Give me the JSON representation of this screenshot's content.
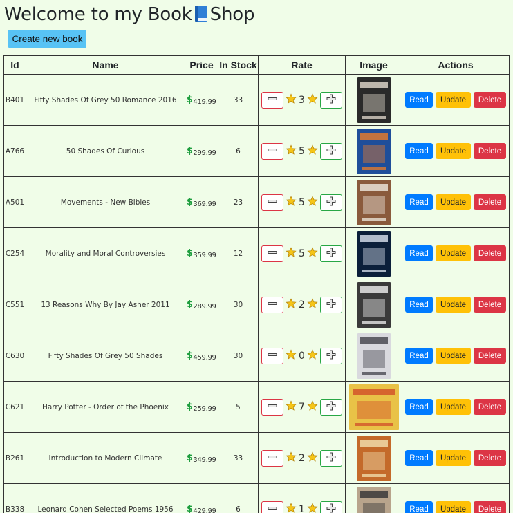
{
  "header": {
    "title_before": "Welcome to my Book",
    "title_after": "Shop",
    "emoji_icon": "blue-book-icon"
  },
  "toolbar": {
    "create_label": "Create new book"
  },
  "table": {
    "columns": [
      "Id",
      "Name",
      "Price",
      "In Stock",
      "Rate",
      "Image",
      "Actions"
    ],
    "action_labels": {
      "read": "Read",
      "update": "Update",
      "delete": "Delete"
    },
    "rows": [
      {
        "id": "B401",
        "name": "Fifty Shades Of Grey 50 Romance 2016",
        "price": "419.99",
        "stock": "33",
        "rate": "3",
        "cover": [
          "#2a2a2a",
          "#d8d0c4"
        ]
      },
      {
        "id": "A766",
        "name": "50 Shades Of Curious",
        "price": "299.99",
        "stock": "6",
        "rate": "5",
        "cover": [
          "#1f4e9a",
          "#e07a2e"
        ]
      },
      {
        "id": "A501",
        "name": "Movements - New Bibles",
        "price": "369.99",
        "stock": "23",
        "rate": "5",
        "cover": [
          "#8a5a3c",
          "#e9e2d6"
        ]
      },
      {
        "id": "C254",
        "name": "Morality and Moral Controversies",
        "price": "359.99",
        "stock": "12",
        "rate": "5",
        "cover": [
          "#0b1f3a",
          "#cfd8e6"
        ]
      },
      {
        "id": "C551",
        "name": "13 Reasons Why By Jay Asher 2011",
        "price": "289.99",
        "stock": "30",
        "rate": "2",
        "cover": [
          "#3a3a3a",
          "#e6e6e6"
        ]
      },
      {
        "id": "C630",
        "name": "Fifty Shades Of Grey 50 Shades",
        "price": "459.99",
        "stock": "30",
        "rate": "0",
        "cover": [
          "#d9d9de",
          "#4a4a52"
        ]
      },
      {
        "id": "C621",
        "name": "Harry Potter - Order of the Phoenix",
        "price": "259.99",
        "stock": "5",
        "rate": "7",
        "cover": [
          "#e9c247",
          "#d2552a"
        ]
      },
      {
        "id": "B261",
        "name": "Introduction to Modern Climate",
        "price": "349.99",
        "stock": "33",
        "rate": "2",
        "cover": [
          "#c46a2a",
          "#f0d9a8"
        ]
      },
      {
        "id": "B338",
        "name": "Leonard Cohen Selected Poems 1956",
        "price": "429.99",
        "stock": "6",
        "rate": "1",
        "cover": [
          "#b8a48c",
          "#3a3a3a"
        ]
      }
    ]
  },
  "icons": {
    "dollar": "dollar-sign-icon",
    "star": "star-icon",
    "minus": "minus-icon",
    "plus": "plus-icon"
  },
  "colors": {
    "background": "#f0fde8",
    "create_button": "#58c3f5",
    "read": "#007bff",
    "update": "#ffc107",
    "delete": "#dc3545",
    "plus_border": "#28a745",
    "minus_border": "#dc3545"
  }
}
